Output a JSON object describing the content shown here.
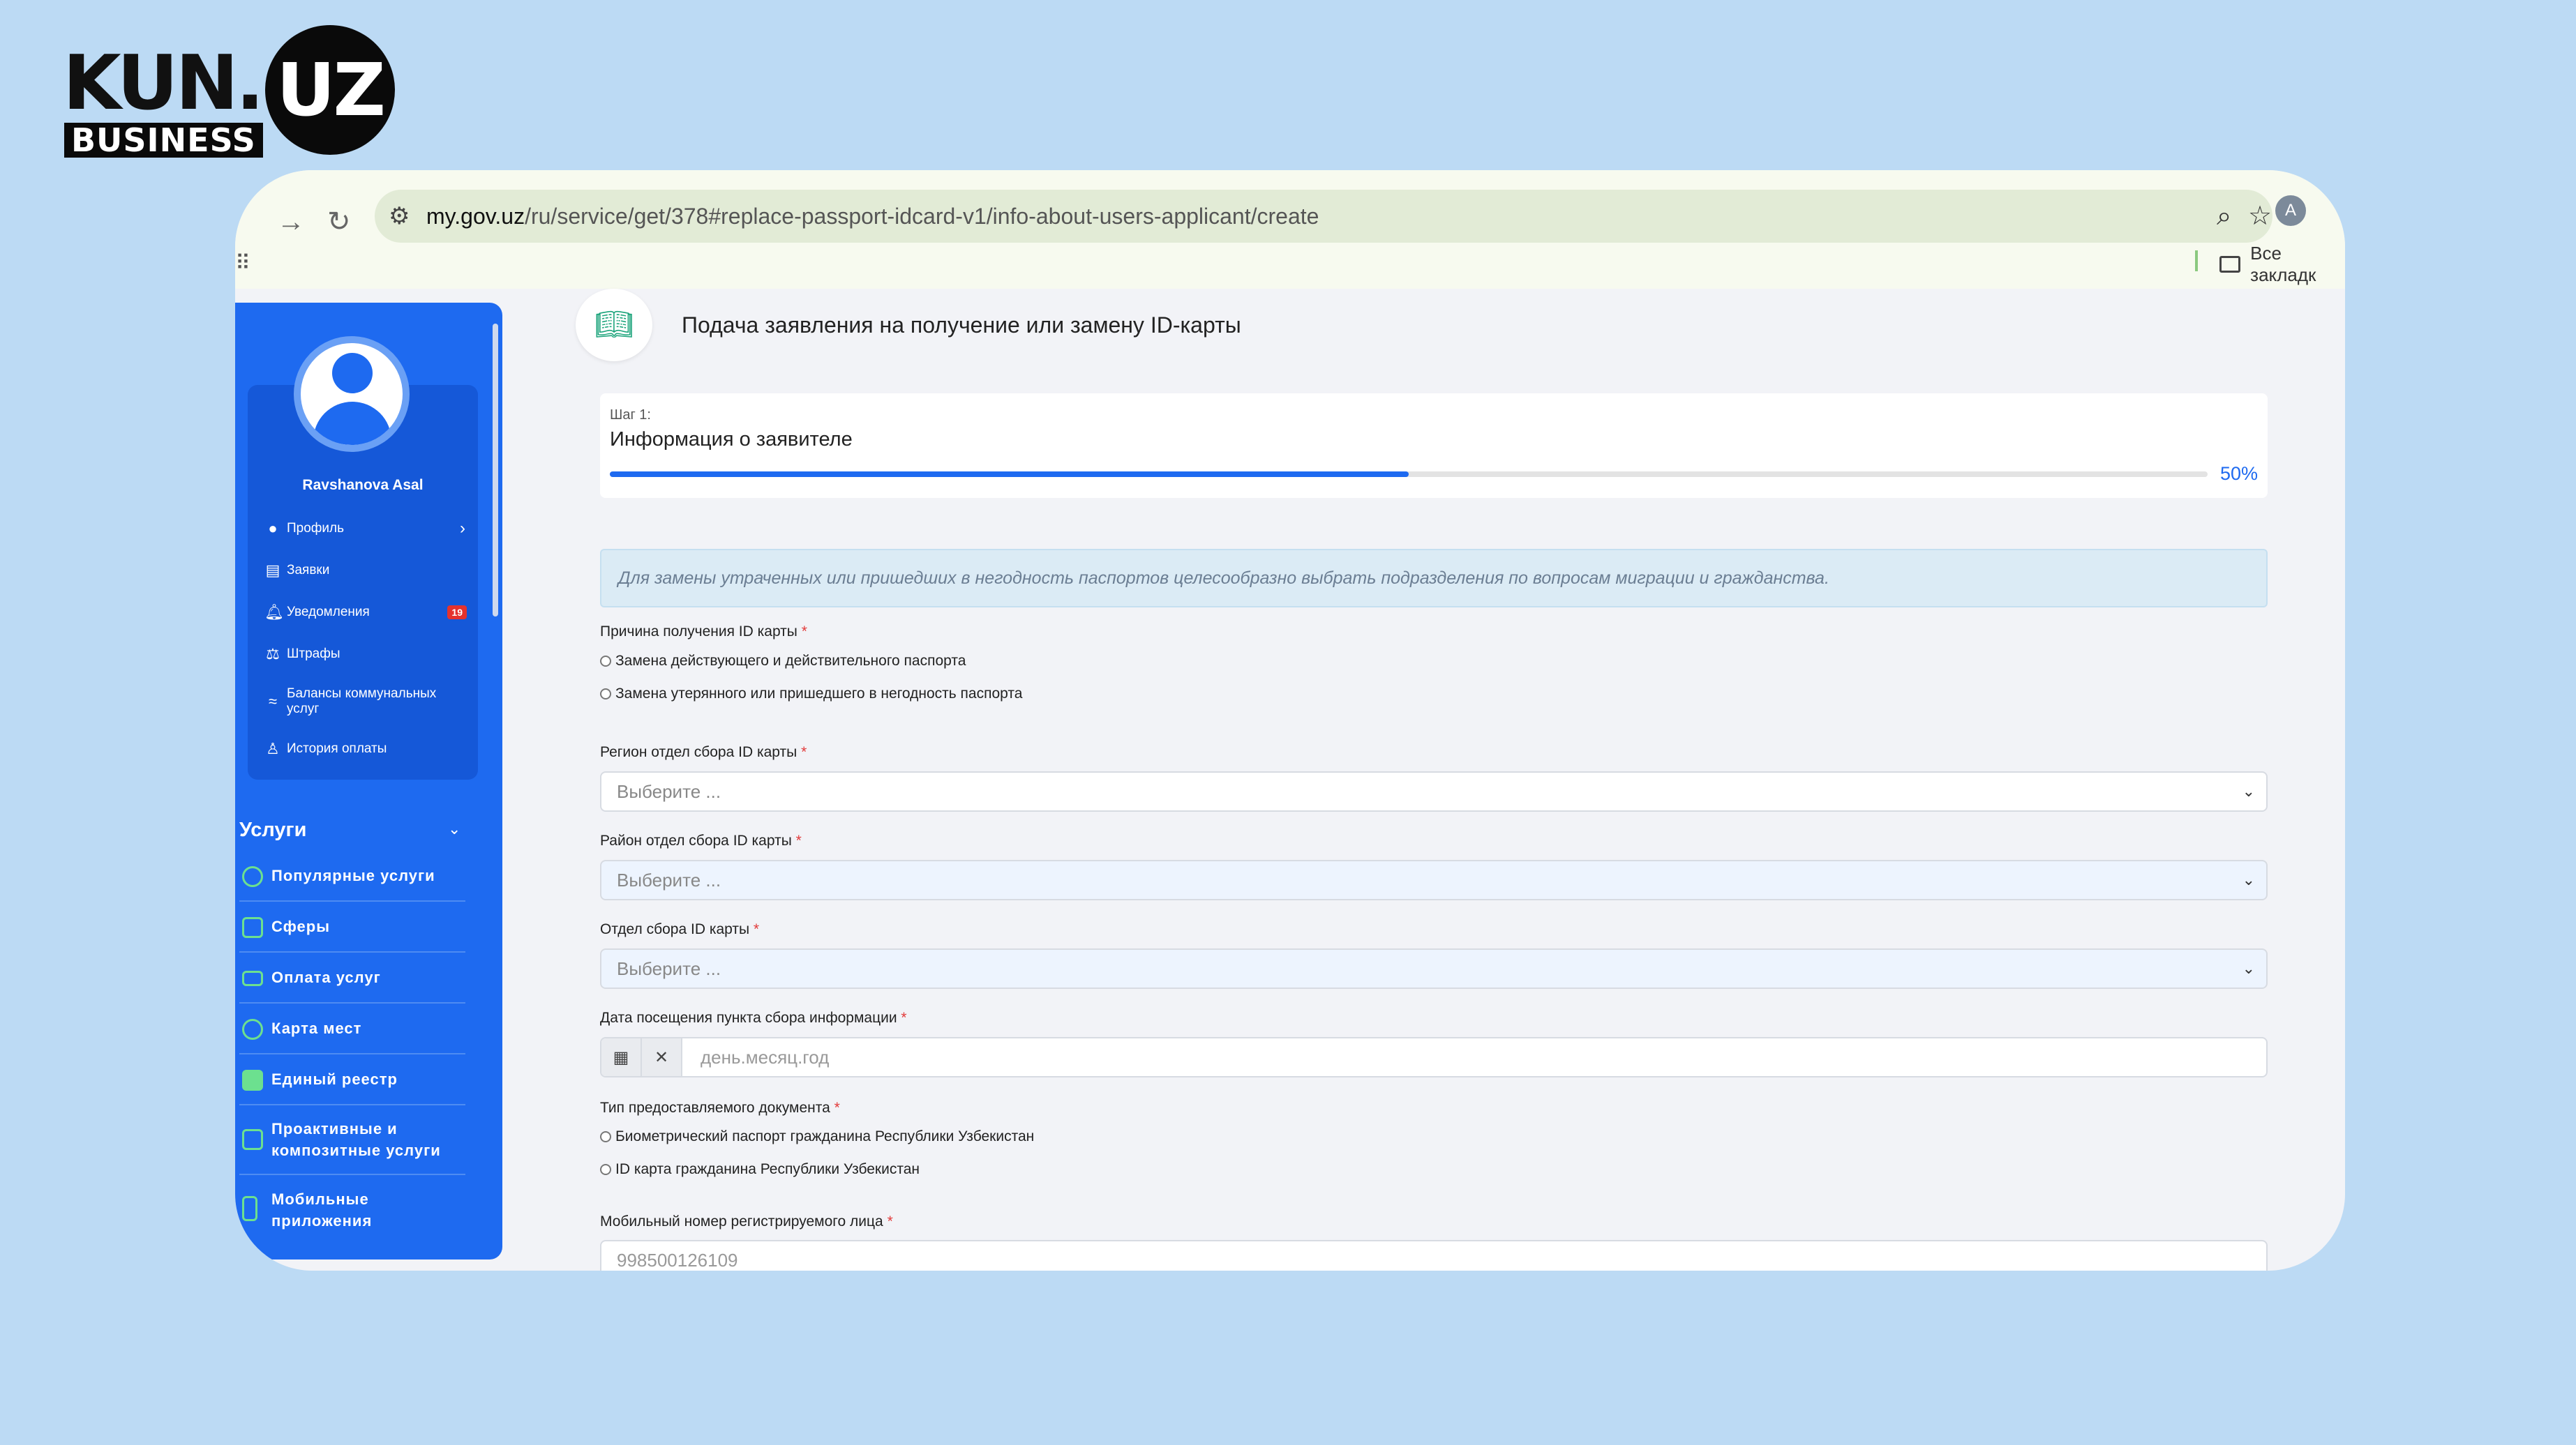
{
  "logo": {
    "kun": "KUN.",
    "uz": "UZ",
    "business": "BUSINESS"
  },
  "browser": {
    "url_host": "my.gov.uz",
    "url_path": "/ru/service/get/378#replace-passport-idcard-v1/info-about-users-applicant/create",
    "bookmarks_label": "Все закладк",
    "profile_initial": "A"
  },
  "sidebar": {
    "user_name": "Ravshanova Asal",
    "menu": [
      {
        "label": "Профиль",
        "icon": "user-icon"
      },
      {
        "label": "Заявки",
        "icon": "document-icon"
      },
      {
        "label": "Уведомления",
        "icon": "bell-icon",
        "badge": "19"
      },
      {
        "label": "Штрафы",
        "icon": "fines-icon"
      },
      {
        "label": "Балансы коммунальных услуг",
        "icon": "utilities-icon"
      },
      {
        "label": "История оплаты",
        "icon": "wallet-icon"
      }
    ],
    "services_title": "Услуги",
    "services": [
      {
        "label": "Популярные услуги",
        "icon": "check-circle-icon"
      },
      {
        "label": "Сферы",
        "icon": "grid-icon"
      },
      {
        "label": "Оплата услуг",
        "icon": "card-icon"
      },
      {
        "label": "Карта мест",
        "icon": "map-pin-icon"
      },
      {
        "label": "Единый реестр",
        "icon": "registry-icon"
      },
      {
        "label": "Проактивные и композитные услуги",
        "icon": "proactive-icon"
      },
      {
        "label": "Мобильные приложения",
        "icon": "mobile-icon"
      }
    ]
  },
  "main": {
    "page_title": "Подача заявления на получение или замену ID-карты",
    "step": {
      "label": "Шаг 1:",
      "title": "Информация о заявителе",
      "progress_percent": 50,
      "progress_text": "50%"
    },
    "alert": "Для замены утраченных или пришедших в негодность паспортов целесообразно выбрать подразделения по вопросам миграции и гражданства.",
    "reason": {
      "label": "Причина получения ID карты",
      "options": [
        "Замена действующего и действительного паспорта",
        "Замена утерянного или пришедшего в негодность паспорта"
      ]
    },
    "region": {
      "label": "Регион отдел сбора ID карты",
      "placeholder": "Выберите ..."
    },
    "district": {
      "label": "Район отдел сбора ID карты",
      "placeholder": "Выберите ..."
    },
    "office": {
      "label": "Отдел сбора ID карты",
      "placeholder": "Выберите ..."
    },
    "visit_date": {
      "label": "Дата посещения пункта сбора информации",
      "placeholder": "день.месяц.год"
    },
    "doc_type": {
      "label": "Тип предоставляемого документа",
      "options": [
        "Биометрический паспорт гражданина Республики Узбекистан",
        "ID карта гражданина Республики Узбекистан"
      ]
    },
    "phone": {
      "label": "Мобильный номер регистрируемого лица",
      "placeholder": "998500126109"
    },
    "required_mark": "*"
  }
}
